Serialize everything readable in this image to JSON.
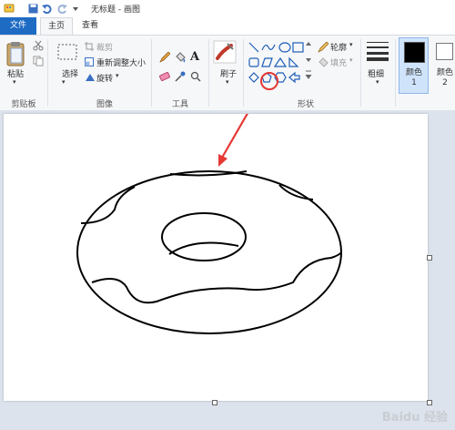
{
  "window": {
    "title": "无标题 - 画图"
  },
  "quick_access": {
    "icons": [
      "app-icon",
      "save-icon",
      "undo-icon",
      "redo-icon",
      "customize-icon"
    ]
  },
  "tabs": {
    "file": "文件",
    "home": "主页",
    "view": "查看"
  },
  "ribbon": {
    "clipboard": {
      "label": "剪贴板",
      "paste": "粘贴"
    },
    "image": {
      "label": "图像",
      "select": "选择",
      "crop": "裁剪",
      "resize": "重新调整大小",
      "rotate": "旋转"
    },
    "tools": {
      "label": "工具",
      "brush": "刷子"
    },
    "shapes": {
      "label": "形状",
      "outline": "轮廓",
      "fill": "填充"
    },
    "size": {
      "label": "粗细"
    },
    "color1": {
      "label": "颜色 1",
      "value": "#000000"
    },
    "color2": {
      "label": "颜色 2",
      "value": "#ffffff"
    }
  },
  "watermark": "Baidu 经验",
  "colors": {
    "file_tab": "#1e6bc4",
    "annotation": "#e53935"
  }
}
